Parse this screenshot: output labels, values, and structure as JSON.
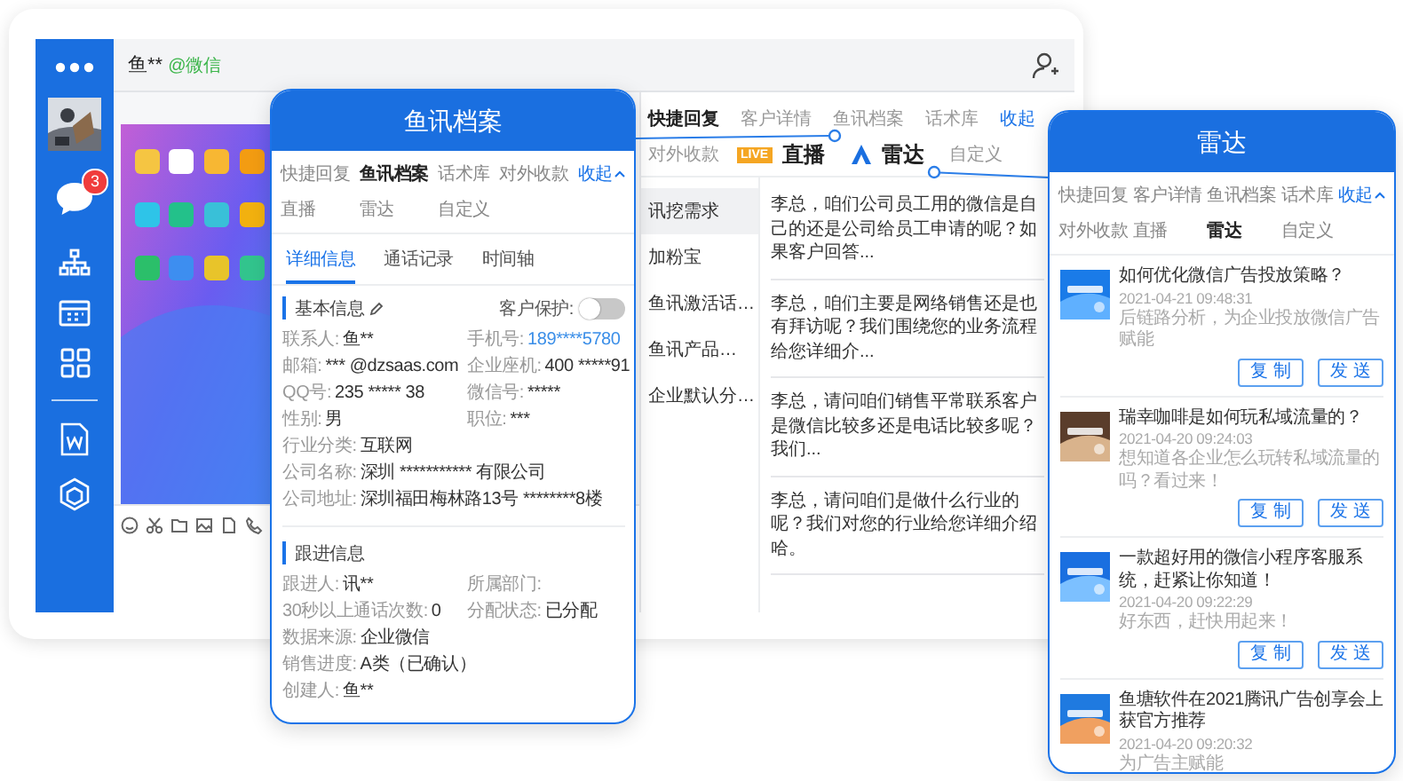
{
  "top_bar": {
    "contact": "鱼**",
    "channel": "@微信"
  },
  "sidebar": {
    "badge": "3"
  },
  "main_tabs": [
    [
      {
        "label": "快捷回复",
        "selected": true,
        "kind": "plain"
      },
      {
        "label": "客户详情",
        "selected": false,
        "kind": "plain"
      },
      {
        "label": "鱼讯档案",
        "selected": false,
        "kind": "plain"
      },
      {
        "label": "话术库",
        "selected": false,
        "kind": "plain"
      },
      {
        "label": "收起",
        "selected": false,
        "kind": "collapse"
      }
    ],
    [
      {
        "label": "对外收款",
        "selected": false,
        "kind": "plain"
      },
      {
        "label": "直播",
        "selected": false,
        "kind": "live",
        "badge": "LIVE"
      },
      {
        "label": "雷达",
        "selected": false,
        "kind": "radar"
      },
      {
        "label": "自定义",
        "selected": false,
        "kind": "plain"
      }
    ]
  ],
  "quick_list": [
    {
      "label": "讯挖需求",
      "selected": true
    },
    {
      "label": "加粉宝",
      "selected": false
    },
    {
      "label": "鱼讯激活话…",
      "selected": false
    },
    {
      "label": "鱼讯产品…",
      "selected": false
    },
    {
      "label": "企业默认分…",
      "selected": false
    }
  ],
  "messages": [
    "李总，咱们公司员工用的微信是自己的还是公司给员工申请的呢？如果客户回答...",
    "李总，咱们主要是网络销售还是也有拜访呢？我们围绕您的业务流程给您详细介...",
    "李总，请问咱们销售平常联系客户是微信比较多还是电话比较多呢？我们...",
    "李总，请问咱们是做什么行业的呢？我们对您的行业给您详细介绍哈。"
  ],
  "archive_card": {
    "title": "鱼讯档案",
    "tabs": [
      {
        "label": "快捷回复",
        "selected": false,
        "kind": "plain"
      },
      {
        "label": "鱼讯档案",
        "selected": true,
        "kind": "plain"
      },
      {
        "label": "话术库",
        "selected": false,
        "kind": "plain"
      },
      {
        "label": "对外收款",
        "selected": false,
        "kind": "plain"
      },
      {
        "label": "收起",
        "selected": false,
        "kind": "collapse"
      },
      {
        "label": "直播",
        "selected": false,
        "kind": "plain"
      },
      {
        "label": "雷达",
        "selected": false,
        "kind": "plain"
      },
      {
        "label": "自定义",
        "selected": false,
        "kind": "plain"
      }
    ],
    "subtabs": [
      {
        "label": "详细信息",
        "selected": true
      },
      {
        "label": "通话记录",
        "selected": false
      },
      {
        "label": "时间轴",
        "selected": false
      }
    ],
    "basic": {
      "title": "基本信息",
      "protection": {
        "label": "客户保护:",
        "on": false
      },
      "fields": [
        {
          "label": "联系人:",
          "value": "鱼**",
          "kind": "half"
        },
        {
          "label": "手机号:",
          "value": "189****5780",
          "kind": "phone"
        },
        {
          "label": "邮箱:",
          "value": "*** @dzsaas.com",
          "kind": "half"
        },
        {
          "label": "企业座机:",
          "value": "400 *****91",
          "kind": "half"
        },
        {
          "label": "QQ号:",
          "value": "235 ***** 38",
          "kind": "half"
        },
        {
          "label": "微信号:",
          "value": "*****",
          "kind": "half"
        },
        {
          "label": "性别:",
          "value": "男",
          "kind": "half"
        },
        {
          "label": "职位:",
          "value": "***",
          "kind": "half"
        },
        {
          "label": "行业分类:",
          "value": "互联网",
          "kind": "wide"
        },
        {
          "label": "公司名称:",
          "value": "深圳 *********** 有限公司",
          "kind": "wide"
        },
        {
          "label": "公司地址:",
          "value": "深圳福田梅林路13号 ********8楼",
          "kind": "wide"
        }
      ]
    },
    "follow": {
      "title": "跟进信息",
      "fields": [
        {
          "label": "跟进人:",
          "value": "讯**",
          "kind": "half"
        },
        {
          "label": "所属部门:",
          "kind": "half"
        },
        {
          "label": "30秒以上通话次数:",
          "value": "0",
          "kind": "half"
        },
        {
          "label": "分配状态:",
          "value": "已分配",
          "kind": "half"
        },
        {
          "label": "数据来源:",
          "value": "企业微信",
          "kind": "wide"
        },
        {
          "label": "销售进度:",
          "value": "A类（已确认）",
          "kind": "wide"
        },
        {
          "label": "创建人:",
          "value": "鱼**",
          "kind": "wide"
        }
      ]
    }
  },
  "radar_card": {
    "title": "雷达",
    "tabs": [
      {
        "label": "快捷回复",
        "selected": false,
        "kind": "plain"
      },
      {
        "label": "客户详情",
        "selected": false,
        "kind": "plain"
      },
      {
        "label": "鱼讯档案",
        "selected": false,
        "kind": "plain"
      },
      {
        "label": "话术库",
        "selected": false,
        "kind": "plain"
      },
      {
        "label": "收起",
        "selected": false,
        "kind": "collapse"
      },
      {
        "label": "对外收款",
        "selected": false,
        "kind": "plain"
      },
      {
        "label": "直播",
        "selected": false,
        "kind": "plain"
      },
      {
        "label": "雷达",
        "selected": true,
        "kind": "plain"
      },
      {
        "label": "自定义",
        "selected": false,
        "kind": "plain"
      }
    ],
    "articles": [
      {
        "title": "如何优化微信广告投放策略？",
        "date": "2021-04-21 09:48:31",
        "summary": "后链路分析，为企业投放微信广告赋能",
        "actions": [
          "复制",
          "发送"
        ]
      },
      {
        "title": "瑞幸咖啡是如何玩私域流量的？",
        "date": "2021-04-20 09:24:03",
        "summary": "想知道各企业怎么玩转私域流量的吗？看过来！",
        "actions": [
          "复制",
          "发送"
        ]
      },
      {
        "title": "一款超好用的微信小程序客服系统，赶紧让你知道！",
        "date": "2021-04-20 09:22:29",
        "summary": "好东西，赶快用起来！",
        "actions": [
          "复制",
          "发送"
        ]
      },
      {
        "title": "鱼塘软件在2021腾讯广告创享会上获官方推荐",
        "date": "2021-04-20 09:20:32",
        "summary": "为广告主赋能"
      }
    ]
  }
}
